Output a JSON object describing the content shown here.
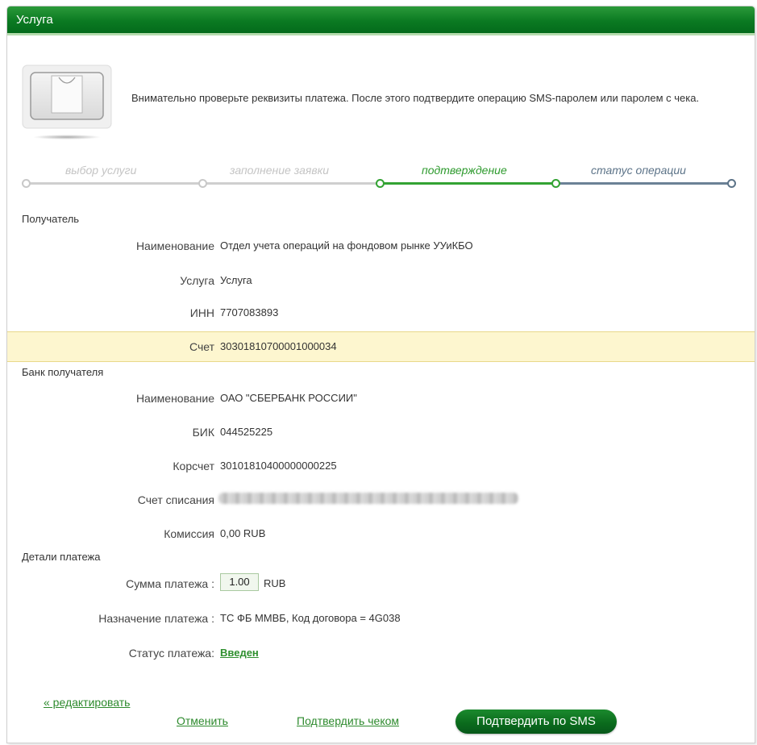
{
  "header": {
    "title": "Услуга"
  },
  "hint": {
    "icon": "shopping-bag-icon",
    "text": "Внимательно проверьте реквизиты платежа. После этого подтвердите операцию SMS-паролем или паролем с чека."
  },
  "steps": [
    {
      "label": "выбор услуги",
      "state": "past"
    },
    {
      "label": "заполнение заявки",
      "state": "past"
    },
    {
      "label": "подтверждение",
      "state": "current"
    },
    {
      "label": "статус операции",
      "state": "future"
    }
  ],
  "recipient": {
    "section_title": "Получатель",
    "name_label": "Наименование",
    "name_value": "Отдел учета операций на фондовом рынке УУиКБО",
    "service_label": "Услуга",
    "service_value": "Услуга",
    "inn_label": "ИНН",
    "inn_value": "7707083893",
    "account_label": "Счет",
    "account_value": "30301810700001000034"
  },
  "bank": {
    "section_title": "Банк получателя",
    "name_label": "Наименование",
    "name_value": "ОАО \"СБЕРБАНК РОССИИ\"",
    "bik_label": "БИК",
    "bik_value": "044525225",
    "corr_label": "Корсчет",
    "corr_value": "30101810400000000225",
    "debit_label": "Счет списания",
    "fee_label": "Комиссия",
    "fee_value": "0,00 RUB"
  },
  "details": {
    "section_title": "Детали платежа",
    "amount_label": "Сумма платежа :",
    "amount_value": "1.00",
    "amount_currency": "RUB",
    "purpose_label": "Назначение платежа :",
    "purpose_value": "ТС ФБ ММВБ, Код договора = 4G038",
    "status_label": "Статус платежа:",
    "status_value": "Введен"
  },
  "actions": {
    "edit_label": "« редактировать",
    "cancel_label": "Отменить",
    "confirm_check_label": "Подтвердить чеком",
    "confirm_sms_label": "Подтвердить по SMS"
  },
  "colors": {
    "header_green": "#0b7a22",
    "current_step": "#2d9a2d",
    "future_step": "#5c7388",
    "highlight_row": "#fdf6cf"
  }
}
